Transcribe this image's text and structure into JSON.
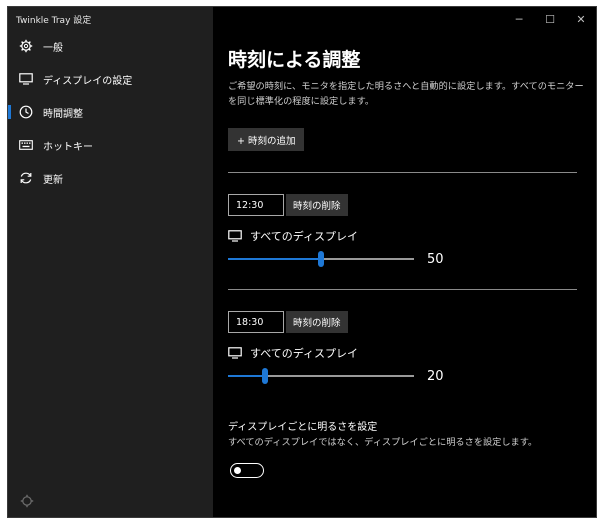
{
  "window": {
    "title": "Twinkle Tray 設定",
    "controls": {
      "minimize": "─",
      "maximize": "☐",
      "close": "✕"
    }
  },
  "sidebar": {
    "items": [
      {
        "label": "一般",
        "icon": "gear-icon",
        "active": false
      },
      {
        "label": "ディスプレイの設定",
        "icon": "monitor-icon",
        "active": false
      },
      {
        "label": "時間調整",
        "icon": "clock-icon",
        "active": true
      },
      {
        "label": "ホットキー",
        "icon": "keyboard-icon",
        "active": false
      },
      {
        "label": "更新",
        "icon": "refresh-icon",
        "active": false
      }
    ]
  },
  "main": {
    "title": "時刻による調整",
    "description": "ご希望の時刻に、モニタを指定した明るさへと自動的に設定します。すべてのモニターを同じ標準化の程度に設定します。",
    "add_button": "+ 時刻の追加",
    "schedules": [
      {
        "time": "12:30",
        "delete_label": "時刻の削除",
        "display_label": "すべてのディスプレイ",
        "value": 50,
        "level": 0.5
      },
      {
        "time": "18:30",
        "delete_label": "時刻の削除",
        "display_label": "すべてのディスプレイ",
        "value": 20,
        "level": 0.2
      }
    ],
    "per_display": {
      "title": "ディスプレイごとに明るさを設定",
      "description": "すべてのディスプレイではなく、ディスプレイごとに明るさを設定します。",
      "enabled": false
    }
  },
  "colors": {
    "accent": "#1e78d6",
    "sidebar_bg": "#1f1f1f",
    "main_bg": "#000000"
  }
}
